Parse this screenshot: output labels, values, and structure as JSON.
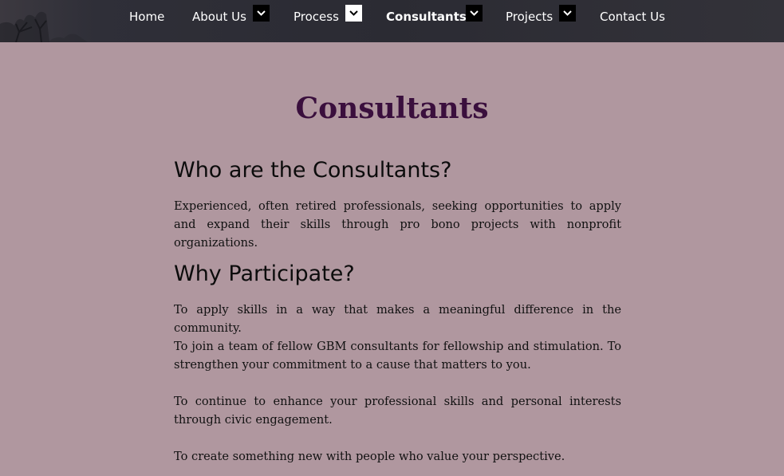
{
  "nav": {
    "items": [
      {
        "label": "Home"
      },
      {
        "label": "About Us"
      },
      {
        "label": "Process"
      },
      {
        "label": "Consultants"
      },
      {
        "label": "Projects"
      },
      {
        "label": "Contact Us"
      }
    ],
    "active": "Consultants"
  },
  "page": {
    "title": "Consultants",
    "sections": [
      {
        "heading": "Who are the Consultants?",
        "paragraphs": [
          "Experienced, often retired professionals, seeking opportunities to apply and expand their skills through pro bono projects with nonprofit organizations."
        ]
      },
      {
        "heading": "Why Participate?",
        "paragraphs": [
          "To apply skills in a way that makes a meaningful difference in the community.",
          "To join a team of fellow GBM consultants for fellowship and stimulation. To strengthen your commitment to a cause that matters to you.",
          "To continue to enhance your professional skills and personal interests through civic engagement.",
          "To create something new with people who value your perspective."
        ]
      }
    ]
  },
  "colors": {
    "background": "#b0979f",
    "title": "#3a0f3d",
    "nav_background": "#2b2b33",
    "nav_text": "#ffffff"
  },
  "icons": {
    "dropdown": "chevron-down-icon"
  }
}
